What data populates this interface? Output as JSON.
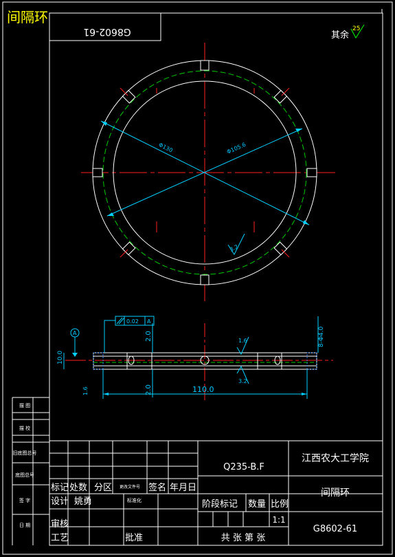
{
  "title_overlay": "间隔环",
  "flipped_code": "G8602-61",
  "surface_roughness": {
    "prefix": "其余",
    "value": "25"
  },
  "dimensions": {
    "outer_dia": "Φ130",
    "inner_dia": "Φ105.6",
    "thickness": "10.0",
    "width": "110.0",
    "offset_top": "2.0",
    "offset_bottom": "2.0",
    "right_dia": "8-Φ4.0",
    "tolerance": "0.02",
    "datum": "A",
    "rough_top": "1.6",
    "rough_bottom": "3.2",
    "rough_ring": "3.2",
    "left_note": "1.6"
  },
  "side_labels": [
    "描 图",
    "描 校",
    "旧底图总号",
    "底图总号",
    "签 字",
    "日 期"
  ],
  "title_block": {
    "material": "Q235-B.F",
    "school": "江西农大工学院",
    "part_name": "间隔环",
    "drawing_no": "G8602-61",
    "scale": "1:1",
    "header_mark": "标记",
    "header_count": "处数",
    "header_zone": "分区",
    "header_file": "更改文件号",
    "header_sign": "签名",
    "header_date": "年月日",
    "design": "设计",
    "designer": "姚勇",
    "standard": "标准化",
    "stage": "阶段标记",
    "qty": "数量",
    "ratio": "比例",
    "review": "审核",
    "process": "工艺",
    "approve": "批准",
    "sheets": "共 张 第 张"
  }
}
